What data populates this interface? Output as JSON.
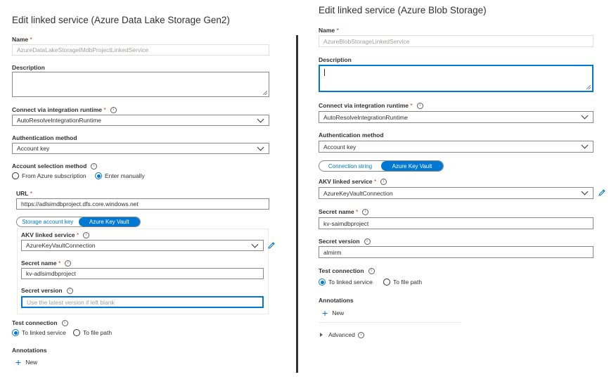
{
  "left": {
    "title": "Edit linked service (Azure Data Lake Storage Gen2)",
    "name_label": "Name",
    "name_value": "AzureDataLakeStorageIMdbProjectLinkedService",
    "description_label": "Description",
    "runtime_label": "Connect via integration runtime",
    "runtime_value": "AutoResolveIntegrationRuntime",
    "auth_label": "Authentication method",
    "auth_value": "Account key",
    "account_selection_label": "Account selection method",
    "from_azure_label": "From Azure subscription",
    "enter_manually_label": "Enter manually",
    "url_label": "URL",
    "url_value": "https://adlsimdbproject.dfs.core.windows.net",
    "toggle_storage_key": "Storage account key",
    "toggle_key_vault": "Azure Key Vault",
    "akv_label": "AKV linked service",
    "akv_value": "AzureKeyVaultConnection",
    "secret_name_label": "Secret name",
    "secret_name_value": "kv-adlsimdbproject",
    "secret_version_label": "Secret version",
    "secret_version_placeholder": "Use the latest version if left blank",
    "test_connection_label": "Test connection",
    "to_linked_service": "To linked service",
    "to_file_path": "To file path",
    "annotations_label": "Annotations",
    "new_label": "New"
  },
  "right": {
    "title": "Edit linked service (Azure Blob Storage)",
    "name_label": "Name",
    "name_value": "AzureBlobStorageLinkedService",
    "description_label": "Description",
    "runtime_label": "Connect via integration runtime",
    "runtime_value": "AutoResolveIntegrationRuntime",
    "auth_label": "Authentication method",
    "auth_value": "Account key",
    "toggle_conn_string": "Connection string",
    "toggle_key_vault": "Azure Key Vault",
    "akv_label": "AKV linked service",
    "akv_value": "AzureKeyVaultConnection",
    "secret_name_label": "Secret name",
    "secret_name_value": "kv-saimdbproject",
    "secret_version_label": "Secret version",
    "secret_version_value": "almirm",
    "test_connection_label": "Test connection",
    "to_linked_service": "To linked service",
    "to_file_path": "To file path",
    "annotations_label": "Annotations",
    "new_label": "New",
    "advanced_label": "Advanced"
  },
  "required_mark": "*",
  "colors": {
    "accent": "#0078d4",
    "required": "#d13438",
    "text": "#323130"
  }
}
